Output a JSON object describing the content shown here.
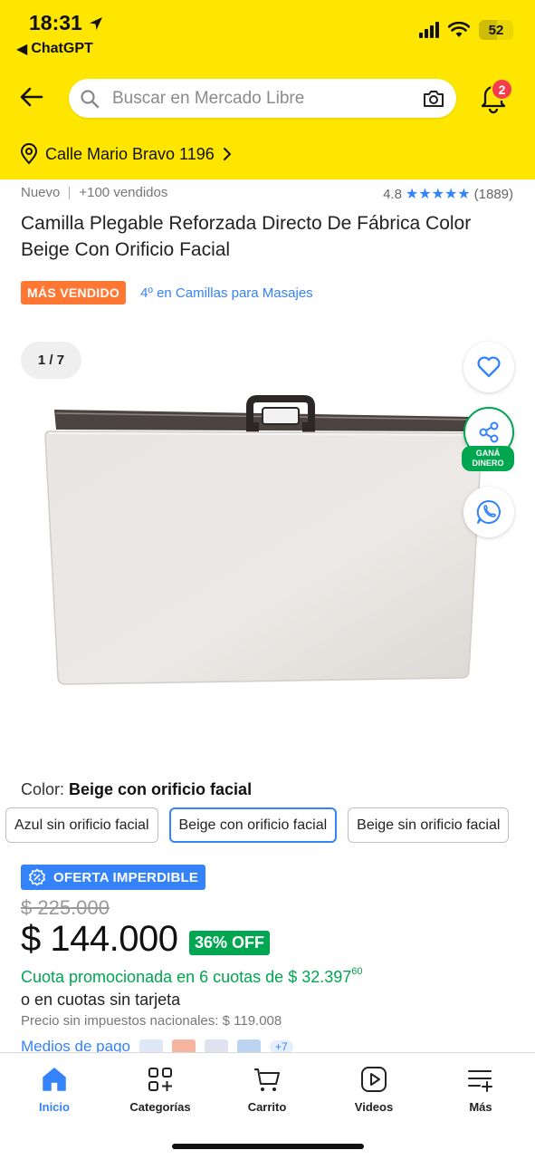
{
  "status_bar": {
    "time": "18:31",
    "back_app": "ChatGPT",
    "battery": "52"
  },
  "header": {
    "search_placeholder": "Buscar en Mercado Libre",
    "notifications_count": "2",
    "address": "Calle Mario Bravo 1196"
  },
  "product": {
    "condition": "Nuevo",
    "sold": "+100 vendidos",
    "rating": "4.8",
    "reviews": "(1889)",
    "title": "Camilla Plegable Reforzada Directo De Fábrica Color Beige Con Orificio Facial",
    "best_seller": "MÁS VENDIDO",
    "ranking": "4º en Camillas para Masajes",
    "image_counter": "1 / 7",
    "share_label_line1": "GANÁ",
    "share_label_line2": "DINERO"
  },
  "variants": {
    "label": "Color: ",
    "selected_value": "Beige con orificio facial",
    "options": [
      "Azul sin orificio facial",
      "Beige con orificio facial",
      "Beige sin orificio facial"
    ],
    "selected_index": 1
  },
  "pricing": {
    "offer_tag": "OFERTA IMPERDIBLE",
    "old_price": "$ 225.000",
    "price": "$ 144.000",
    "discount": "36% OFF",
    "installments_text": "Cuota promocionada en 6 cuotas de $ 32.397",
    "installments_cents": "60",
    "no_card": "o en cuotas sin tarjeta",
    "no_tax": "Precio sin impuestos nacionales: $ 119.008",
    "payment_methods": "Medios de pago",
    "more_methods": "+7"
  },
  "bottom_nav": {
    "items": [
      "Inicio",
      "Categorías",
      "Carrito",
      "Videos",
      "Más"
    ],
    "active_index": 0
  },
  "colors": {
    "header_yellow": "#ffe600",
    "link_blue": "#3483fa",
    "green": "#00a650",
    "orange": "#ff7733",
    "badge_red": "#f23d4f"
  }
}
